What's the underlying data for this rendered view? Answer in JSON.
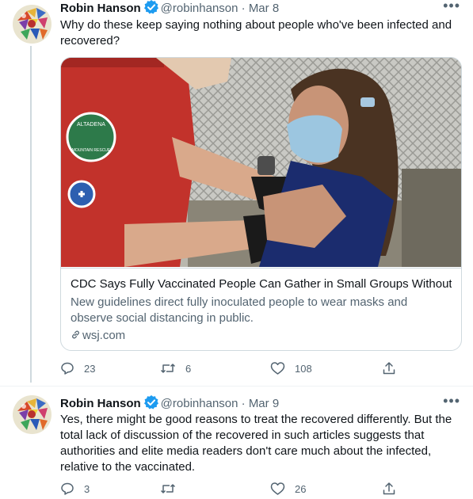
{
  "tweets": [
    {
      "author_name": "Robin Hanson",
      "handle": "@robinhanson",
      "separator": "·",
      "date": "Mar 8",
      "more": "•••",
      "text": "Why do these keep saying nothing about people who've been infected and recovered?",
      "card": {
        "title": "CDC Says Fully Vaccinated People Can Gather in Small Groups Without...",
        "description": "New guidelines direct fully inoculated people to wear masks and observe social distancing in public.",
        "domain": "wsj.com",
        "image_patches": [
          "ALTADENA",
          "MOUNTAIN RESCUE"
        ]
      },
      "replies": "23",
      "retweets": "6",
      "likes": "108"
    },
    {
      "author_name": "Robin Hanson",
      "handle": "@robinhanson",
      "separator": "·",
      "date": "Mar 9",
      "more": "•••",
      "text": "Yes, there might be good reasons to treat the recovered differently. But the total lack of discussion of the recovered in such articles suggests that authorities and elite media readers don't care much about the infected, relative to the vaccinated.",
      "replies": "3",
      "retweets": "",
      "likes": "26"
    }
  ],
  "colors": {
    "text_primary": "#0f1419",
    "text_secondary": "#536471",
    "verified_blue": "#1d9bf0",
    "border": "#cfd9de"
  },
  "icons": {
    "verified": "verified-badge-icon",
    "reply": "reply-icon",
    "retweet": "retweet-icon",
    "like": "like-icon",
    "share": "share-icon",
    "link": "link-icon"
  }
}
